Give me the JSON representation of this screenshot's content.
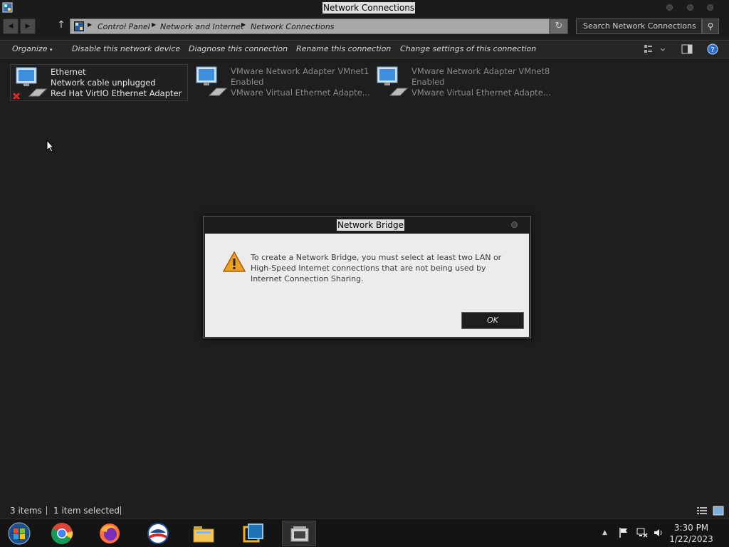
{
  "window": {
    "title": "Network Connections"
  },
  "address": {
    "crumbs": [
      "Control Panel",
      "Network and Internet",
      "Network Connections"
    ],
    "search_placeholder": "Search Network Connections"
  },
  "commands": {
    "organize": "Organize",
    "disable": "Disable this network device",
    "diagnose": "Diagnose this connection",
    "rename": "Rename this connection",
    "change": "Change settings of this connection"
  },
  "connections": [
    {
      "name": "Ethernet",
      "status": "Network cable unplugged",
      "device": "Red Hat VirtIO Ethernet Adapter",
      "selected": true,
      "error": true
    },
    {
      "name": "VMware Network Adapter VMnet1",
      "status": "Enabled",
      "device": "VMware Virtual Ethernet Adapte...",
      "selected": false,
      "error": false
    },
    {
      "name": "VMware Network Adapter VMnet8",
      "status": "Enabled",
      "device": "VMware Virtual Ethernet Adapte...",
      "selected": false,
      "error": false
    }
  ],
  "dialog": {
    "title": "Network Bridge",
    "message": "To create a Network Bridge, you must select at least two LAN or High-Speed Internet connections that are not being used by Internet Connection Sharing.",
    "ok_label": "OK"
  },
  "status": {
    "items": "3 items",
    "selected": "1 item selected"
  },
  "clock": {
    "time": "3:30 PM",
    "date": "1/22/2023"
  },
  "colors": {
    "background": "#1e1e1e",
    "dialog_body": "#ececec",
    "warning": "#f0a020",
    "error": "#d8262a"
  }
}
